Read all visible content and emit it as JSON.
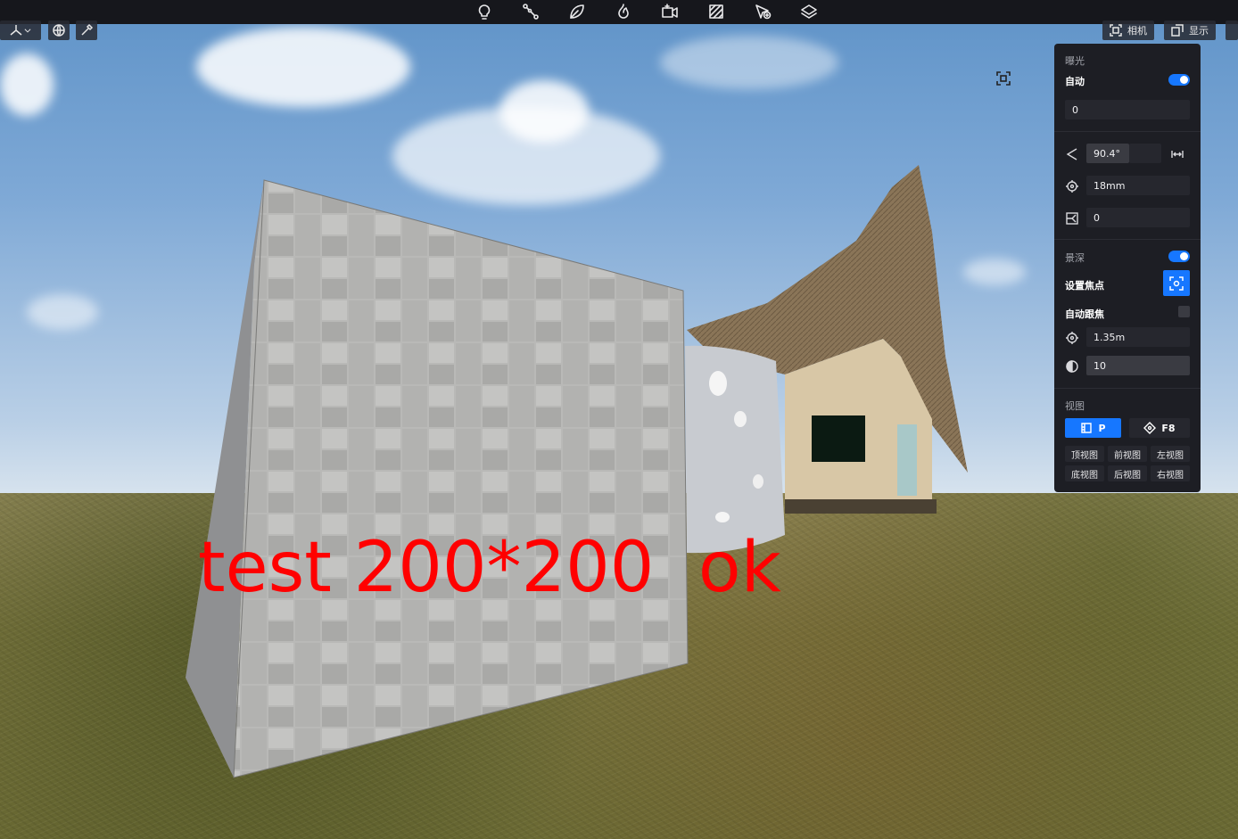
{
  "accent": "#1677ff",
  "overlay": {
    "text": "test 200*200  ok",
    "color": "#ff0000"
  },
  "toolbar": {
    "tools": [
      {
        "name": "light-bulb-icon"
      },
      {
        "name": "path-nodes-icon"
      },
      {
        "name": "leaf-icon"
      },
      {
        "name": "flame-icon"
      },
      {
        "name": "video-camera-icon"
      },
      {
        "name": "texture-pattern-icon"
      },
      {
        "name": "cursor-add-icon"
      },
      {
        "name": "layers-icon"
      }
    ]
  },
  "top_right": {
    "camera_label": "相机",
    "display_label": "显示"
  },
  "panel": {
    "exposure": {
      "title": "曝光",
      "auto_label": "自动",
      "auto_on": true,
      "value": "0"
    },
    "camera": {
      "fov": "90.4°",
      "focal_length": "18mm",
      "rotation": "0"
    },
    "dof": {
      "title": "景深",
      "enabled": true,
      "set_focus_label": "设置焦点",
      "auto_focus_label": "自动跟焦",
      "auto_focus_on": false,
      "focus_distance": "1.35m",
      "aperture": "10"
    },
    "view": {
      "title": "视图",
      "perspective_label": "P",
      "fly_label": "F8",
      "buttons": [
        "顶视图",
        "前视图",
        "左视图",
        "底视图",
        "后视图",
        "右视图"
      ]
    }
  }
}
